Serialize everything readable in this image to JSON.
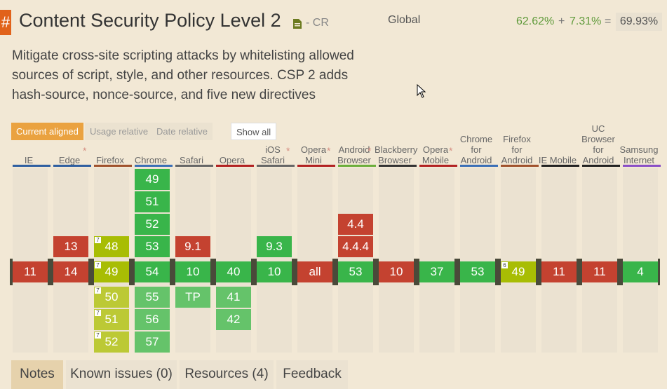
{
  "feature": {
    "hash": "#",
    "title": "Content Security Policy Level 2",
    "status": "- CR",
    "description_lines": [
      "Mitigate cross-site scripting attacks by whitelisting allowed",
      "sources of script, style, and other resources. CSP 2 adds",
      "hash-source, nonce-source, and five new directives"
    ]
  },
  "usage": {
    "label": "Global",
    "supported": "62.62%",
    "plus": "+",
    "partial": "7.31%",
    "equals": "=",
    "total": "69.93%"
  },
  "controls": {
    "current_aligned": "Current aligned",
    "usage_relative": "Usage relative",
    "date_relative": "Date relative",
    "show_all": "Show all"
  },
  "colors": {
    "yes": "#39b54a",
    "no": "#c44230",
    "partial": "#a8bd04",
    "yes_future": "#65c36a",
    "partial_future": "#bcc935"
  },
  "browsers": [
    {
      "name": "IE",
      "star": false,
      "bar": "#2f5fa0",
      "prev": [],
      "current": {
        "v": "11",
        "s": "n"
      },
      "future": []
    },
    {
      "name": "Edge",
      "star": true,
      "bar": "#2f5fa0",
      "prev": [
        {
          "v": "13",
          "s": "n"
        }
      ],
      "current": {
        "v": "14",
        "s": "n"
      },
      "future": []
    },
    {
      "name": "Firefox",
      "star": false,
      "bar": "#a0522d",
      "prev": [
        {
          "v": "48",
          "s": "p",
          "note": "7"
        }
      ],
      "current": {
        "v": "49",
        "s": "p",
        "note": "7"
      },
      "future": [
        {
          "v": "50",
          "s": "p",
          "note": "7"
        },
        {
          "v": "51",
          "s": "p",
          "note": "7"
        },
        {
          "v": "52",
          "s": "p",
          "note": "7"
        }
      ]
    },
    {
      "name": "Chrome",
      "star": false,
      "bar": "#3b6fb6",
      "prev": [
        {
          "v": "49",
          "s": "y"
        },
        {
          "v": "51",
          "s": "y"
        },
        {
          "v": "52",
          "s": "y"
        },
        {
          "v": "53",
          "s": "y"
        }
      ],
      "current": {
        "v": "54",
        "s": "y"
      },
      "future": [
        {
          "v": "55",
          "s": "y"
        },
        {
          "v": "56",
          "s": "y"
        },
        {
          "v": "57",
          "s": "y"
        }
      ]
    },
    {
      "name": "Safari",
      "star": false,
      "bar": "#666666",
      "prev": [
        {
          "v": "9.1",
          "s": "n"
        }
      ],
      "current": {
        "v": "10",
        "s": "y"
      },
      "future": [
        {
          "v": "TP",
          "s": "y"
        }
      ]
    },
    {
      "name": "Opera",
      "star": false,
      "bar": "#b22222",
      "prev": [],
      "current": {
        "v": "40",
        "s": "y"
      },
      "future": [
        {
          "v": "41",
          "s": "y"
        },
        {
          "v": "42",
          "s": "y"
        }
      ]
    },
    {
      "name": "iOS Safari",
      "star": true,
      "bar": "#666666",
      "prev": [
        {
          "v": "9.3",
          "s": "y"
        }
      ],
      "current": {
        "v": "10",
        "s": "y"
      },
      "future": []
    },
    {
      "name": "Opera Mini",
      "star": true,
      "bar": "#b22222",
      "prev": [],
      "current": {
        "v": "all",
        "s": "n"
      },
      "future": []
    },
    {
      "name": "Android Browser",
      "star": true,
      "bar": "#6cae3c",
      "prev": [
        {
          "v": "4.4",
          "s": "n"
        },
        {
          "v": "4.4.4",
          "s": "n"
        }
      ],
      "current": {
        "v": "53",
        "s": "y"
      },
      "future": []
    },
    {
      "name": "Blackberry Browser",
      "star": false,
      "bar": "#333333",
      "prev": [],
      "current": {
        "v": "10",
        "s": "n"
      },
      "future": []
    },
    {
      "name": "Opera Mobile",
      "star": true,
      "bar": "#b22222",
      "prev": [],
      "current": {
        "v": "37",
        "s": "y"
      },
      "future": []
    },
    {
      "name": "Chrome for Android",
      "star": false,
      "bar": "#3b6fb6",
      "prev": [],
      "current": {
        "v": "53",
        "s": "y"
      },
      "future": []
    },
    {
      "name": "Firefox for Android",
      "star": false,
      "bar": "#a0522d",
      "prev": [],
      "current": {
        "v": "49",
        "s": "p",
        "note": "6"
      },
      "future": []
    },
    {
      "name": "IE Mobile",
      "star": false,
      "bar": "#222222",
      "prev": [],
      "current": {
        "v": "11",
        "s": "n"
      },
      "future": []
    },
    {
      "name": "UC Browser for Android",
      "star": false,
      "bar": "#222222",
      "prev": [],
      "current": {
        "v": "11",
        "s": "n"
      },
      "future": []
    },
    {
      "name": "Samsung Internet",
      "star": false,
      "bar": "#8a4fc6",
      "prev": [],
      "current": {
        "v": "4",
        "s": "y"
      },
      "future": []
    }
  ],
  "tabs": [
    {
      "label": "Notes",
      "active": true
    },
    {
      "label": "Known issues (0)",
      "active": false
    },
    {
      "label": "Resources (4)",
      "active": false
    },
    {
      "label": "Feedback",
      "active": false
    }
  ]
}
